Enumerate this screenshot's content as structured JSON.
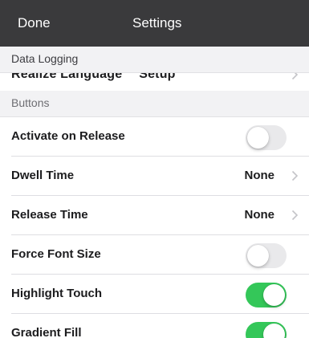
{
  "navbar": {
    "done_label": "Done",
    "title": "Settings",
    "background": "#3a3a3c"
  },
  "sections": {
    "data_logging": {
      "header": "Data Logging",
      "partial_row_label": "Realize Language™ Setup"
    },
    "buttons": {
      "header": "Buttons",
      "rows": [
        {
          "label": "Activate on Release",
          "control": "toggle",
          "on": false
        },
        {
          "label": "Dwell Time",
          "control": "disclosure",
          "value": "None"
        },
        {
          "label": "Release Time",
          "control": "disclosure",
          "value": "None"
        },
        {
          "label": "Force Font Size",
          "control": "toggle",
          "on": false
        },
        {
          "label": "Highlight Touch",
          "control": "toggle",
          "on": true
        },
        {
          "label": "Gradient Fill",
          "control": "toggle",
          "on": true
        }
      ]
    }
  },
  "colors": {
    "toggle_on": "#34c759",
    "toggle_off": "#e9e9eb",
    "section_header_bg": "#f2f2f4"
  }
}
